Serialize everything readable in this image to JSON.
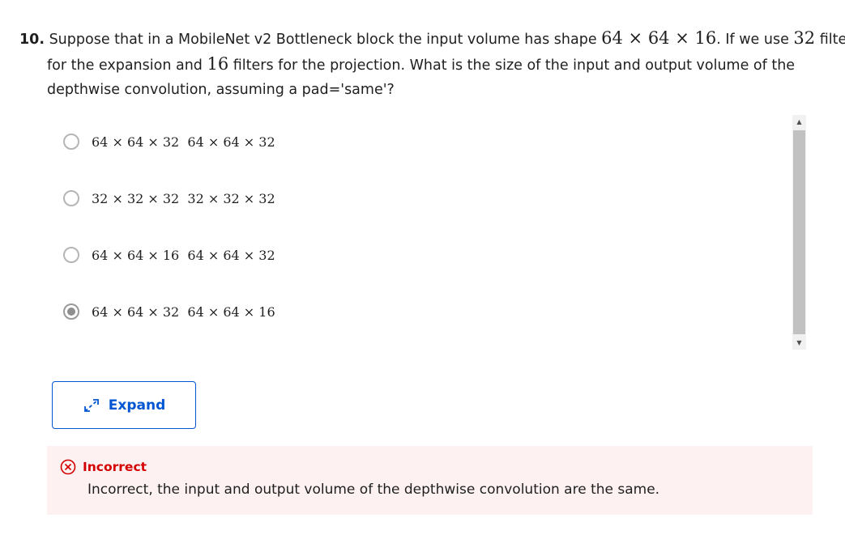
{
  "question": {
    "number": "10.",
    "line1_text_a": " Suppose that in a MobileNet v2 Bottleneck block the input volume has shape ",
    "line1_math_a": "64 × 64 × 16",
    "line1_text_b": ". If we use ",
    "line1_math_b": "32",
    "line1_text_c": " filters",
    "line2_text_a": "for the expansion and ",
    "line2_math_a": "16",
    "line2_text_b": " filters for the projection. What is the size of the input and output volume of the",
    "line3_text": "depthwise convolution, assuming a pad='same'?"
  },
  "options": [
    {
      "label": "64 × 64 × 32  64 × 64 × 32",
      "selected": false
    },
    {
      "label": "32 × 32 × 32  32 × 32 × 32",
      "selected": false
    },
    {
      "label": "64 × 64 × 16  64 × 64 × 32",
      "selected": false
    },
    {
      "label": "64 × 64 × 32  64 × 64 × 16",
      "selected": true
    }
  ],
  "expand_button": {
    "label": "Expand",
    "icon": "expand-arrows-icon"
  },
  "feedback": {
    "status": "Incorrect",
    "icon": "x-circle-icon",
    "message": "Incorrect, the input and output volume of the depthwise convolution are the same."
  },
  "colors": {
    "accent": "#0056d2",
    "error": "#d30001",
    "error_background": "#fdf1f1"
  }
}
